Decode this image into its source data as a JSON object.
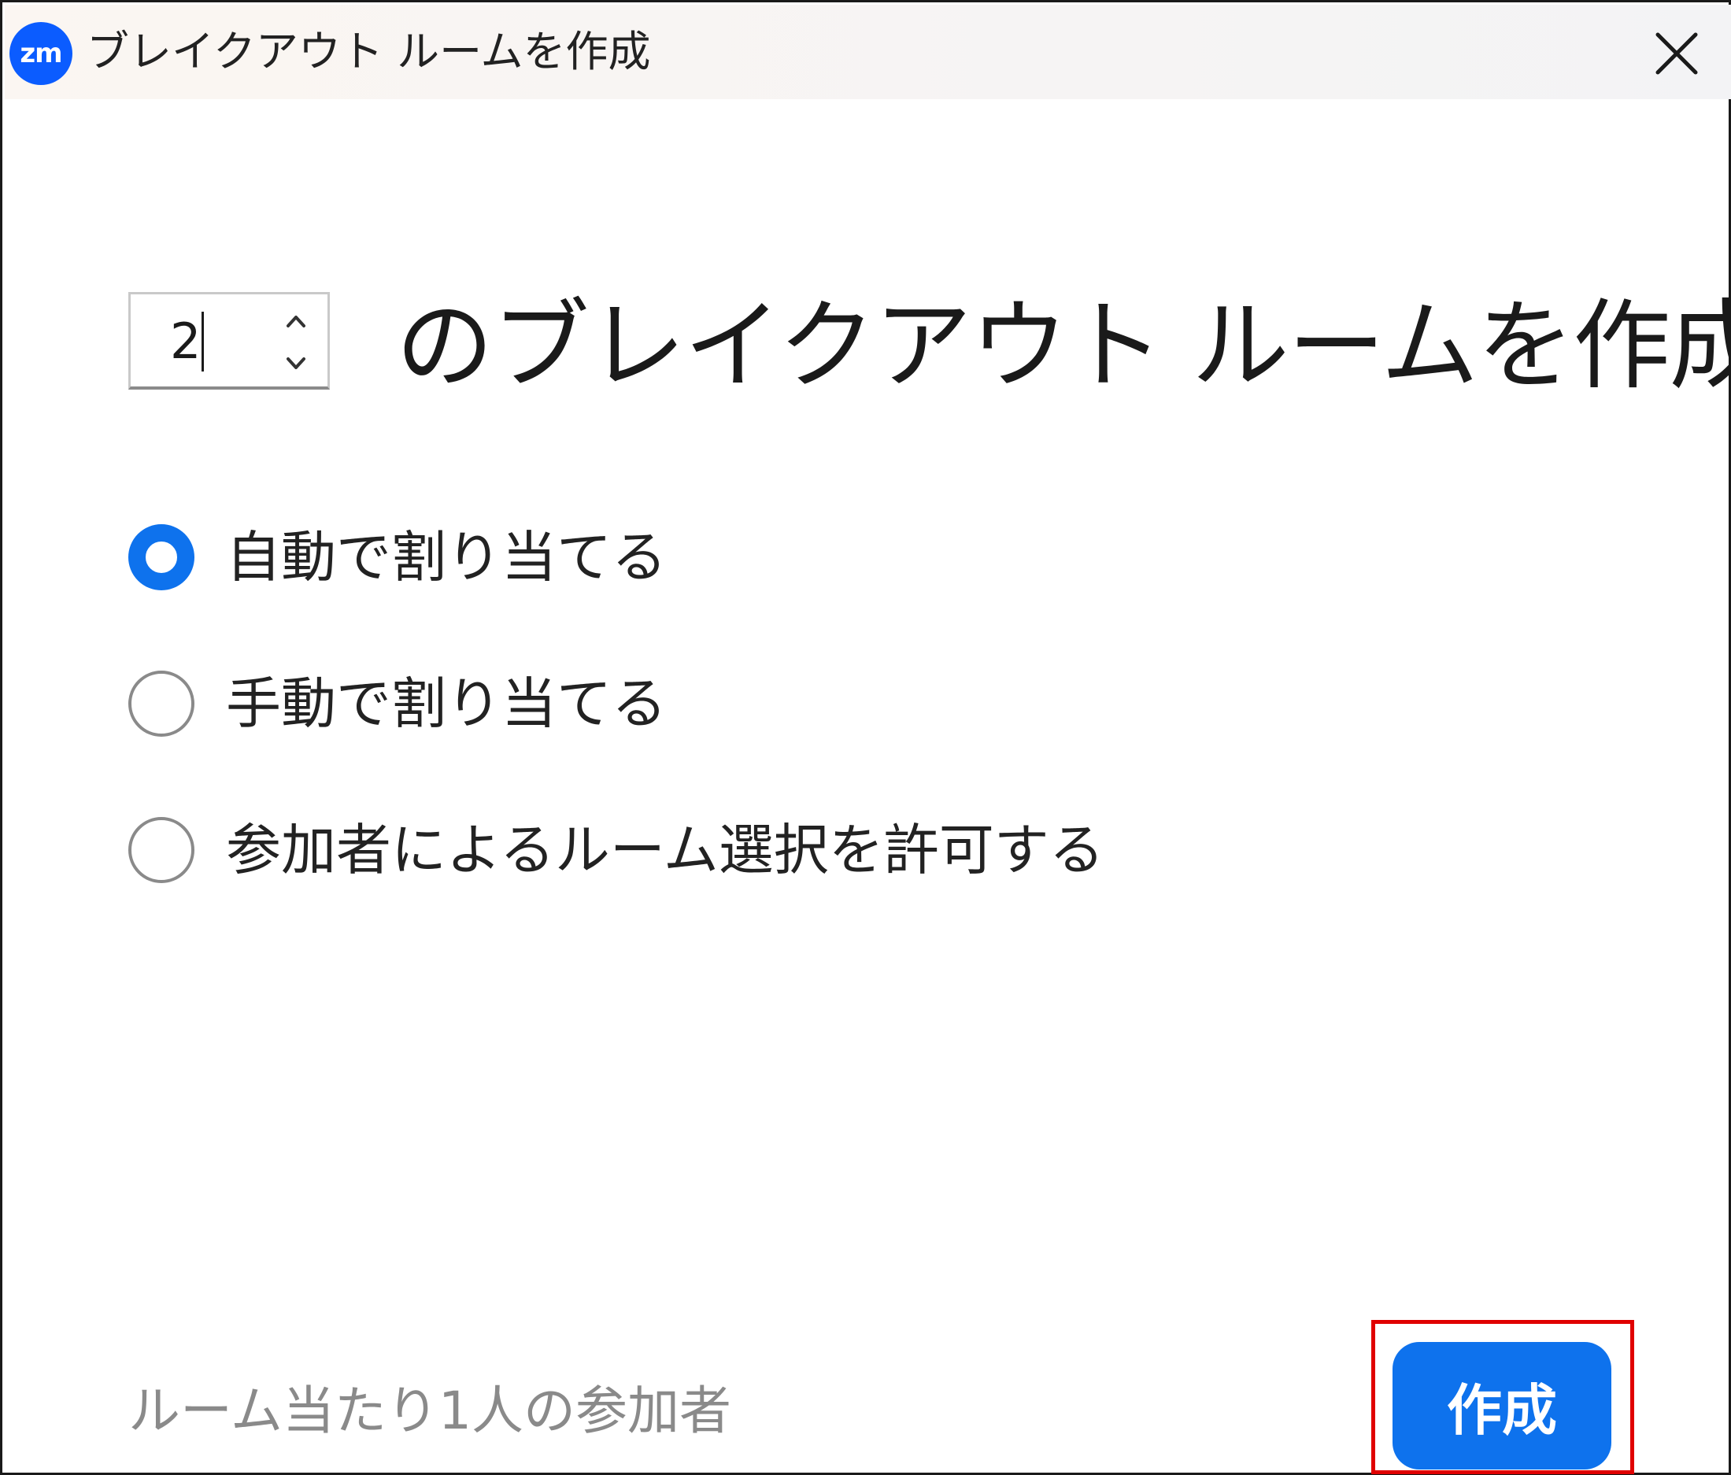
{
  "window": {
    "app_logo_text": "zm",
    "title": "ブレイクアウト ルームを作成"
  },
  "room_count": {
    "value": "2"
  },
  "heading": "のブレイクアウト ルームを作成",
  "assignment_options": [
    {
      "label": "自動で割り当てる",
      "selected": true
    },
    {
      "label": "手動で割り当てる",
      "selected": false
    },
    {
      "label": "参加者によるルーム選択を許可する",
      "selected": false
    }
  ],
  "footer": {
    "participants_per_room": "ルーム当たり1人の参加者",
    "create_label": "作成"
  },
  "colors": {
    "accent": "#0e72ed",
    "logo": "#0b5cff",
    "highlight": "#e00000",
    "muted_text": "#8a8a8a"
  }
}
